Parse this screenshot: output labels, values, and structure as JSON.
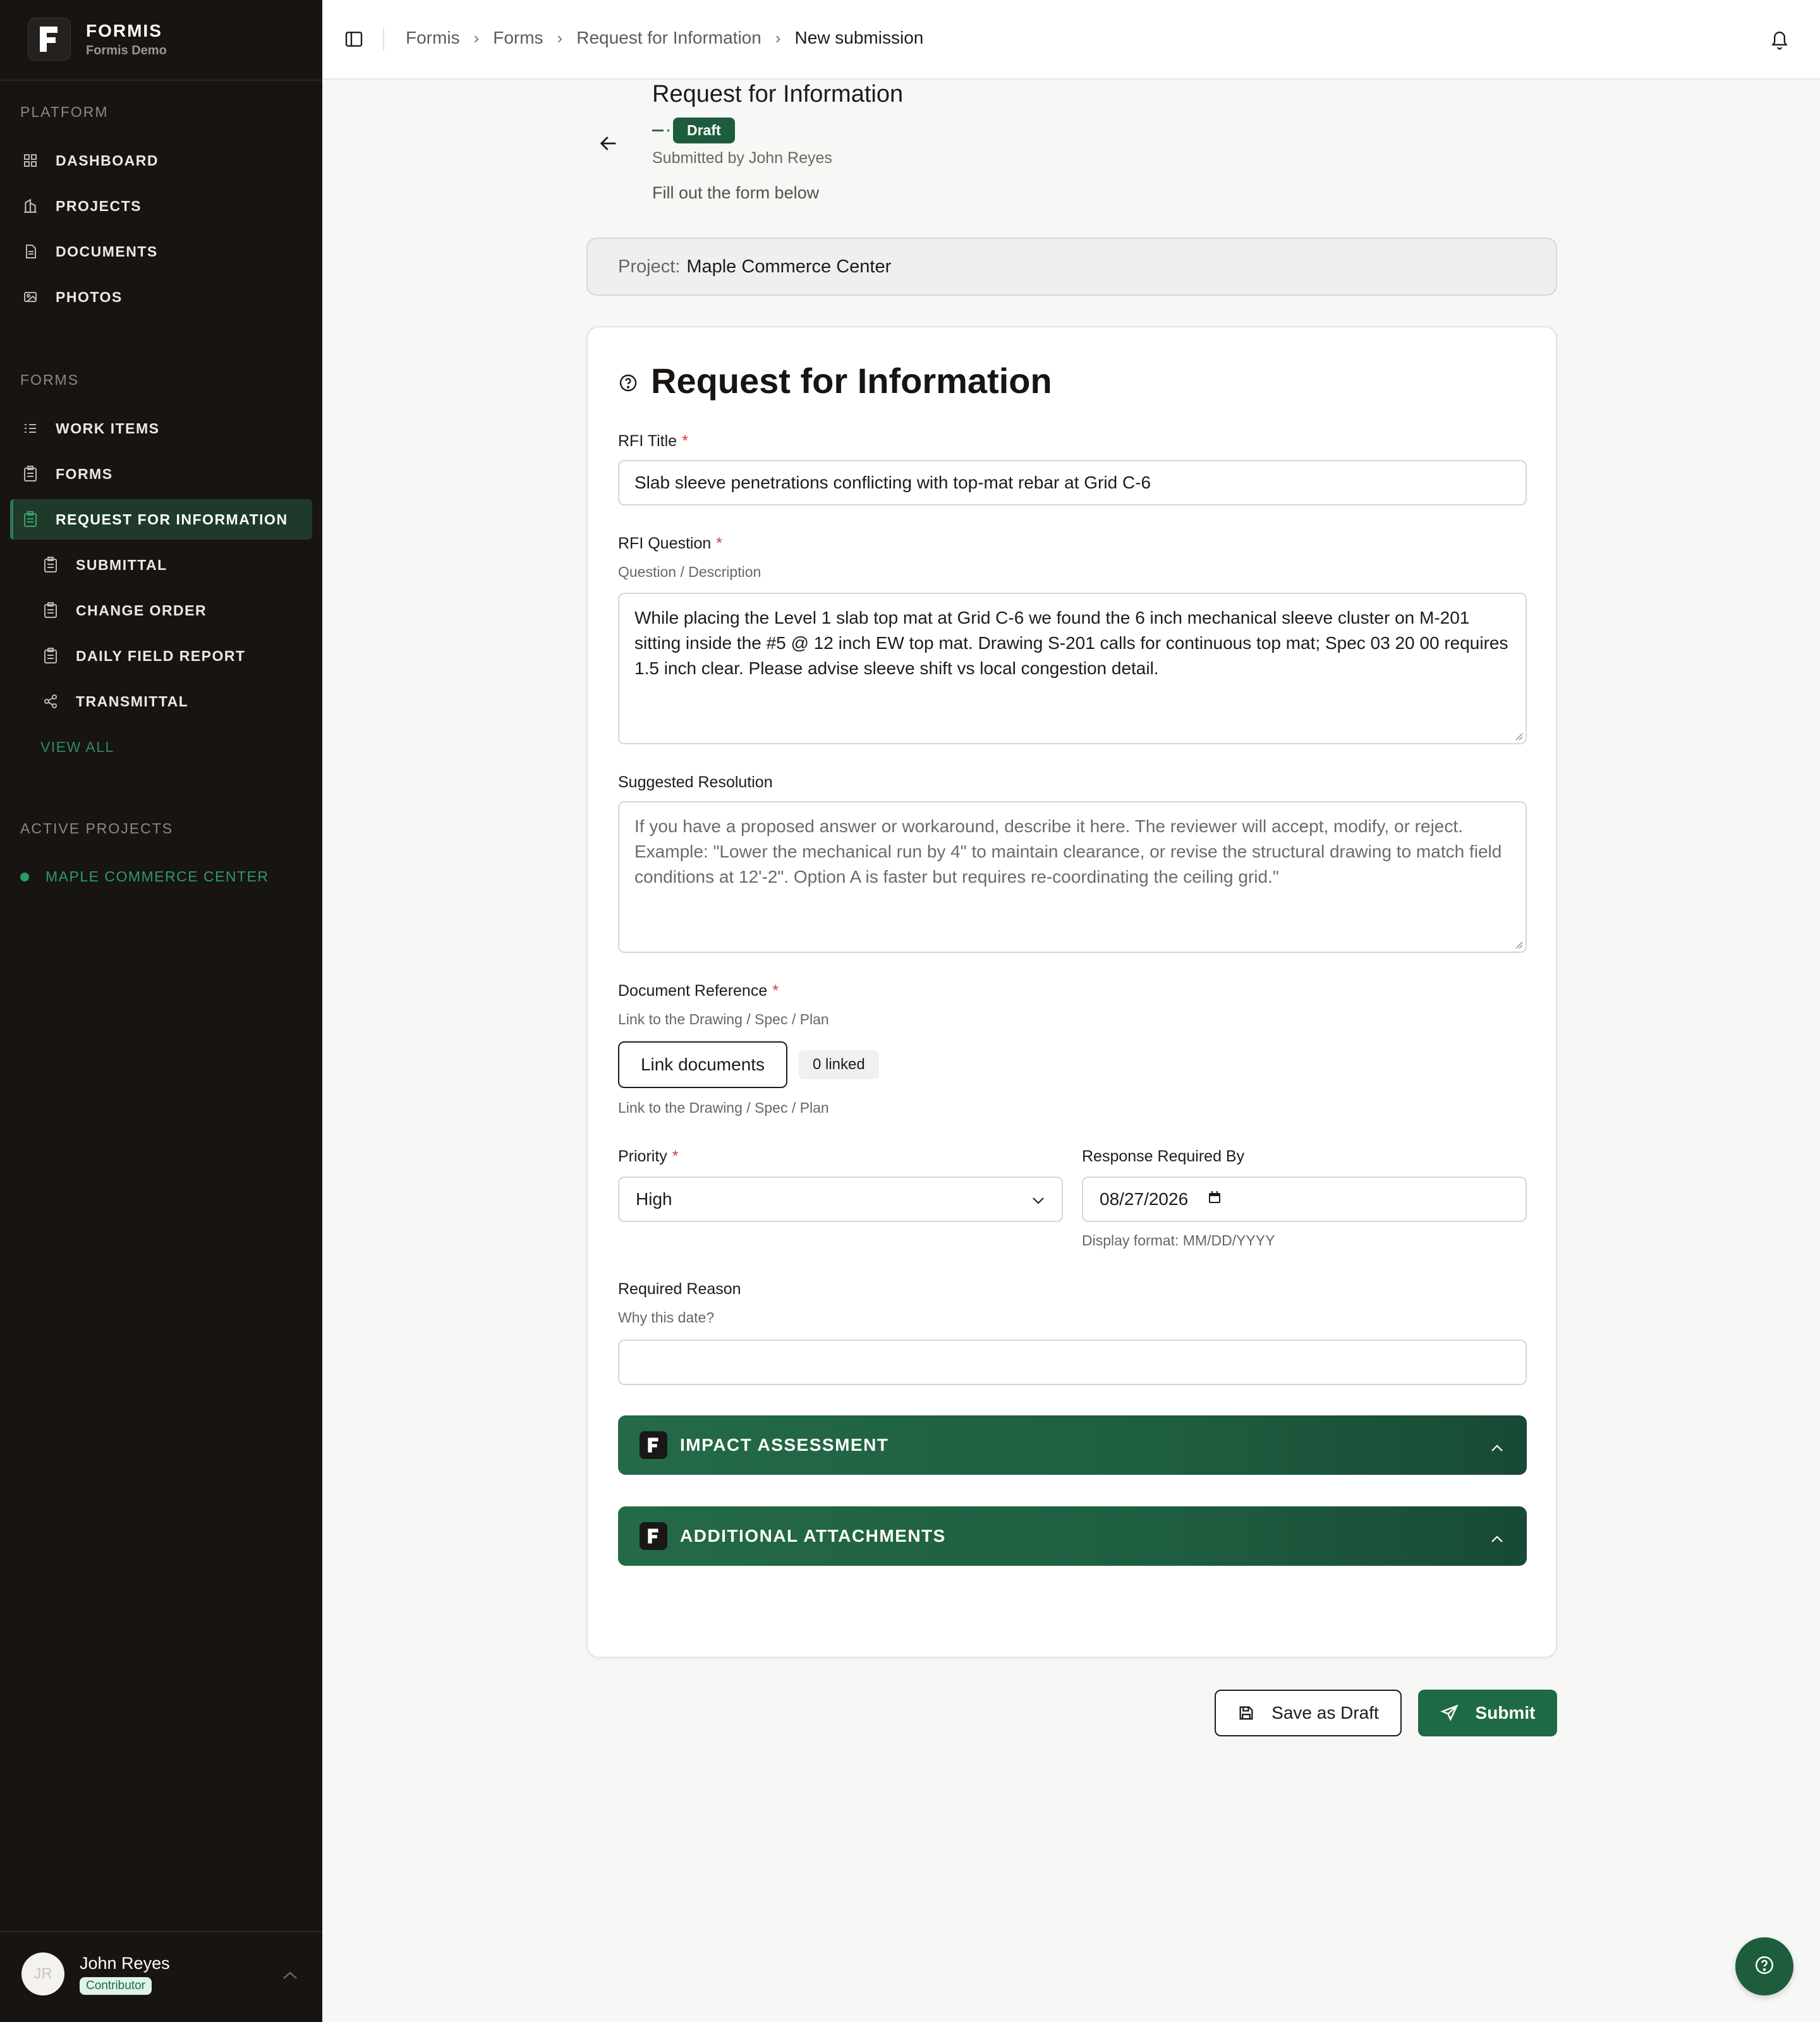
{
  "app": {
    "name": "FORMIS",
    "org": "Formis Demo"
  },
  "sidebar": {
    "platform_label": "PLATFORM",
    "platform_items": [
      {
        "label": "DASHBOARD",
        "icon": "grid-icon"
      },
      {
        "label": "PROJECTS",
        "icon": "building-icon"
      },
      {
        "label": "DOCUMENTS",
        "icon": "document-icon"
      },
      {
        "label": "PHOTOS",
        "icon": "photo-icon"
      }
    ],
    "forms_label": "FORMS",
    "forms_items": [
      {
        "label": "WORK ITEMS",
        "icon": "list-icon"
      },
      {
        "label": "FORMS",
        "icon": "clipboard-icon"
      },
      {
        "label": "REQUEST FOR INFORMATION",
        "icon": "clipboard-icon",
        "active": true
      },
      {
        "label": "SUBMITTAL",
        "icon": "clipboard-icon"
      },
      {
        "label": "CHANGE ORDER",
        "icon": "clipboard-icon"
      },
      {
        "label": "DAILY FIELD REPORT",
        "icon": "clipboard-icon"
      },
      {
        "label": "TRANSMITTAL",
        "icon": "share-icon"
      }
    ],
    "view_all": "VIEW ALL",
    "active_projects_label": "ACTIVE PROJECTS",
    "active_project": "MAPLE COMMERCE CENTER",
    "user": {
      "name": "John Reyes",
      "initials": "JR",
      "role": "Contributor"
    }
  },
  "breadcrumb": [
    "Formis",
    "Forms",
    "Request for Information",
    "New submission"
  ],
  "header": {
    "title": "Request for Information",
    "status": "Draft",
    "submitted_by": "Submitted by John Reyes",
    "hint": "Fill out the form below"
  },
  "project": {
    "label": "Project:",
    "name": "Maple Commerce Center"
  },
  "form": {
    "title": "Request for Information",
    "rfi_title": {
      "label": "RFI Title",
      "required": "*",
      "value": "Slab sleeve penetrations conflicting with top-mat rebar at Grid C-6"
    },
    "rfi_question": {
      "label": "RFI Question",
      "required": "*",
      "help": "Question / Description",
      "value": "While placing the Level 1 slab top mat at Grid C-6 we found the 6 inch mechanical sleeve cluster on M-201 sitting inside the #5 @ 12 inch EW top mat. Drawing S-201 calls for continuous top mat; Spec 03 20 00 requires 1.5 inch clear. Please advise sleeve shift vs local congestion detail."
    },
    "suggested_resolution": {
      "label": "Suggested Resolution",
      "placeholder": "If you have a proposed answer or workaround, describe it here. The reviewer will accept, modify, or reject. Example: \"Lower the mechanical run by 4\" to maintain clearance, or revise the structural drawing to match field conditions at 12'-2\". Option A is faster but requires re-coordinating the ceiling grid.\""
    },
    "document_reference": {
      "label": "Document Reference",
      "required": "*",
      "help": "Link to the Drawing / Spec / Plan",
      "button": "Link documents",
      "linked_count": "0 linked",
      "help_below": "Link to the Drawing / Spec / Plan"
    },
    "priority": {
      "label": "Priority",
      "required": "*",
      "value": "High"
    },
    "response_required_by": {
      "label": "Response Required By",
      "value": "08/27/2026",
      "help": "Display format: MM/DD/YYYY"
    },
    "required_reason": {
      "label": "Required Reason",
      "help": "Why this date?",
      "value": ""
    },
    "sections": [
      "IMPACT ASSESSMENT",
      "ADDITIONAL ATTACHMENTS"
    ]
  },
  "actions": {
    "save_draft": "Save as Draft",
    "submit": "Submit"
  },
  "colors": {
    "brand_green": "#1e6a46",
    "sidebar_bg": "#171412",
    "accent_green": "#2e9a65",
    "required": "#d23b3b"
  }
}
